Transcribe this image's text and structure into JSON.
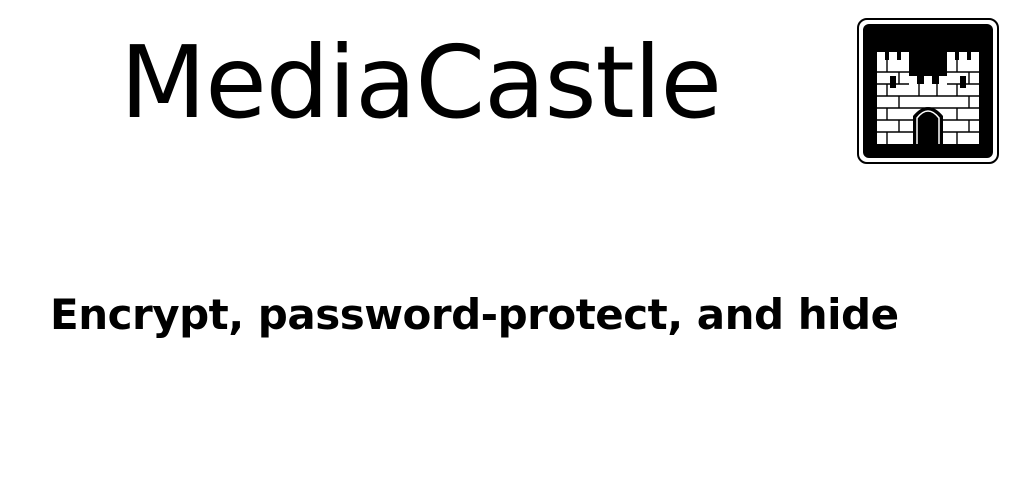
{
  "header": {
    "app_title": "MediaCastle"
  },
  "logo": {
    "icon": "castle-icon",
    "background_color": "#000000",
    "foreground_color": "#ffffff"
  },
  "main": {
    "tagline": "Encrypt, password-protect, and hide"
  }
}
